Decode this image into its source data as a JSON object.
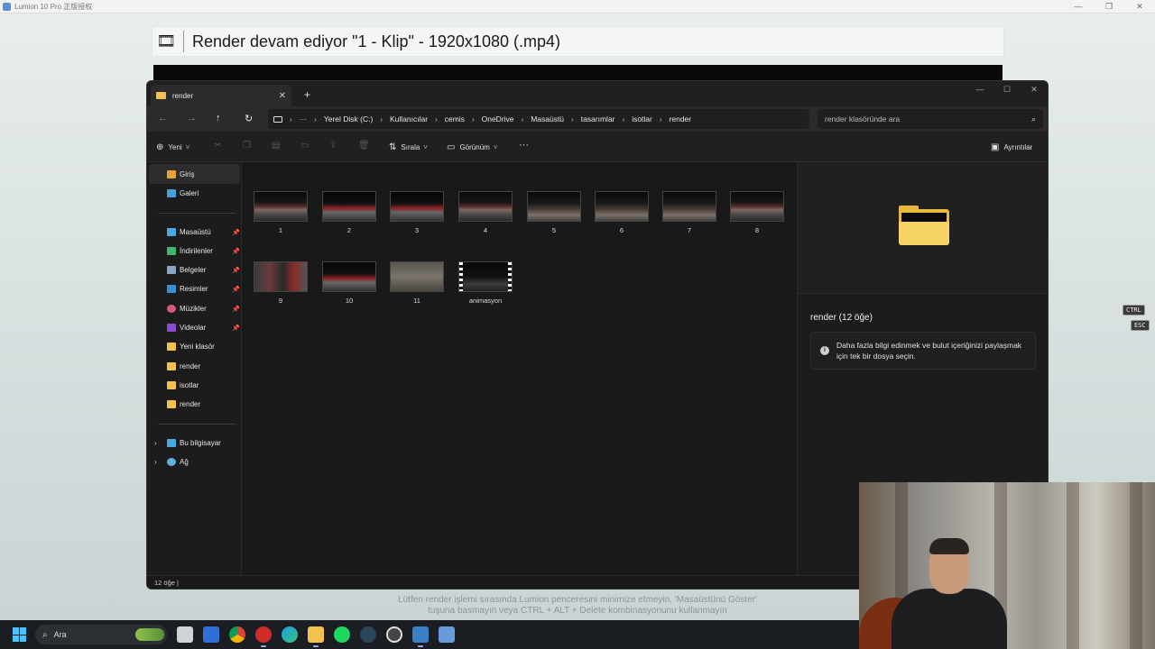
{
  "lumion": {
    "window_title": "Lumion 10 Pro 正版授权",
    "render_title": "Render devam ediyor \"1 - Klip\" - 1920x1080 (.mp4)",
    "hint_line1": "Lütfen render işlemi sırasında Lumion penceresini minimize etmeyin, 'Masaüstünü Göster'",
    "hint_line2": "tuşuna basmayın veya CTRL + ALT + Delete kombinasyonunu kullanmayın",
    "key_ctrl": "CTRL",
    "key_esc": "ESC"
  },
  "explorer": {
    "tab_label": "render",
    "new_tab": "+",
    "breadcrumbs": [
      "Yerel Disk (C:)",
      "Kullanıcılar",
      "cemis",
      "OneDrive",
      "Masaüstü",
      "tasarımlar",
      "isotlar",
      "render"
    ],
    "overflow": "···",
    "search_placeholder": "render klasöründe ara",
    "toolbar": {
      "new_label": "Yeni",
      "sort_label": "Sırala",
      "view_label": "Görünüm",
      "more_label": "···",
      "details_label": "Ayrıntılar"
    },
    "sidebar": {
      "home": "Giriş",
      "gallery": "Galeri",
      "pinned": [
        "Masaüstü",
        "İndirilenler",
        "Belgeler",
        "Resimler",
        "Müzikler",
        "Videolar"
      ],
      "folders": [
        "Yeni klasör",
        "render",
        "isotlar",
        "render"
      ],
      "this_pc": "Bu bilgisayar",
      "network": "Ağ"
    },
    "files": [
      "1",
      "2",
      "3",
      "4",
      "5",
      "6",
      "7",
      "8",
      "9",
      "10",
      "11",
      "animasyon"
    ],
    "details": {
      "title": "render (12 öğe)",
      "info": "Daha fazla bilgi edinmek ve bulut içeriğinizi paylaşmak için tek bir dosya seçin."
    },
    "status": "12 öğe  |"
  },
  "taskbar": {
    "search_label": "Ara"
  },
  "colors": {
    "explorer_bg": "#191919",
    "folder": "#f2c14e",
    "accent": "#4cc2ff"
  }
}
